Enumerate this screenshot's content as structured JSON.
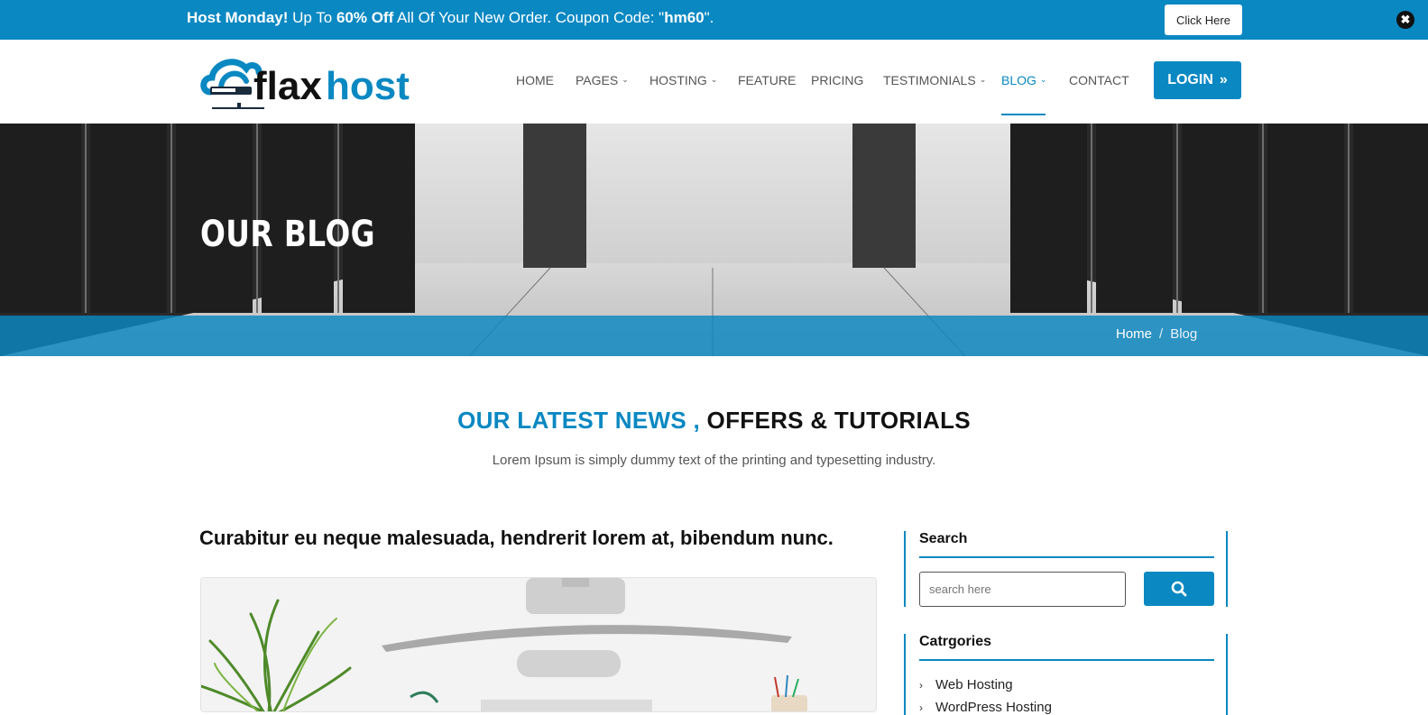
{
  "promo": {
    "lead": "Host Monday!",
    "text1": " Up To ",
    "discount": "60% Off",
    "text2": " All Of Your New Order. Coupon Code: \"",
    "code": "hm60",
    "text3": "\".",
    "button": "Click Here",
    "close_icon": "close-icon"
  },
  "brand": {
    "logo_text_dark": "flax",
    "logo_text_blue": "host",
    "accent": "#0a88c2"
  },
  "nav": {
    "items": [
      {
        "label": "HOME",
        "dropdown": false
      },
      {
        "label": "PAGES",
        "dropdown": true
      },
      {
        "label": "HOSTING",
        "dropdown": true
      },
      {
        "label": "FEATURE",
        "dropdown": false
      },
      {
        "label": "PRICING",
        "dropdown": false
      },
      {
        "label": "TESTIMONIALS",
        "dropdown": true
      },
      {
        "label": "BLOG",
        "dropdown": true,
        "active": true
      },
      {
        "label": "CONTACT",
        "dropdown": false
      }
    ],
    "login": "LOGIN",
    "login_icon": "double-chevron-right-icon"
  },
  "hero": {
    "title": "OUR BLOG",
    "breadcrumb": {
      "home": "Home",
      "separator": "/",
      "current": "Blog"
    }
  },
  "section": {
    "title_blue": "OUR LATEST NEWS ,",
    "title_dark": " OFFERS & TUTORIALS",
    "subtitle": "Lorem Ipsum is simply dummy text of the printing and typesetting industry."
  },
  "post": {
    "title": "Curabitur eu neque malesuada, hendrerit lorem at, bibendum nunc."
  },
  "sidebar": {
    "search": {
      "title": "Search",
      "placeholder": "search here",
      "button_icon": "search-icon"
    },
    "categories": {
      "title": "Catrgories",
      "items": [
        "Web Hosting",
        "WordPress Hosting"
      ]
    }
  }
}
